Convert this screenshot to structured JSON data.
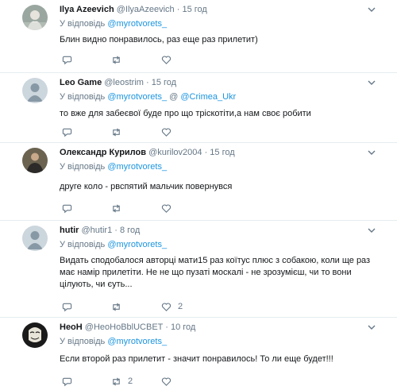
{
  "tweets": [
    {
      "name": "Ilya Azeevich",
      "handle": "@IlyaAzeevich",
      "time": "15 год",
      "reply_prefix": "У відповідь",
      "reply_to": [
        "@myrotvorets_"
      ],
      "lines": [
        "Блин видно понравилось,  раз еще раз прилетит)"
      ],
      "reply_count": "",
      "retweet_count": "",
      "like_count": ""
    },
    {
      "name": "Leo Game",
      "handle": "@leostrim",
      "time": "15 год",
      "reply_prefix": "У відповідь",
      "reply_to": [
        "@myrotvorets_",
        "@Crimea_Ukr"
      ],
      "lines": [
        "то вже для     забеєвої буде про що тріскотіти,а нам своє робити"
      ],
      "reply_count": "",
      "retweet_count": "",
      "like_count": ""
    },
    {
      "name": "Олександр Курилов",
      "handle": "@kurilov2004",
      "time": "15 год",
      "reply_prefix": "У відповідь",
      "reply_to": [
        "@myrotvorets_"
      ],
      "lines": [
        "друге коло - рвспятий мальчик повернувся"
      ],
      "reply_count": "",
      "retweet_count": "",
      "like_count": ""
    },
    {
      "name": "hutir",
      "handle": "@hutir1",
      "time": "8 год",
      "reply_prefix": "У відповідь",
      "reply_to": [
        "@myrotvorets_"
      ],
      "lines": [
        "Видать сподобалося авторці мати15 раз  коїтус плюс з собакою, коли ще раз",
        "має намір прилетіти. Не не що пузаті москалі - не зрозумієш, чи то вони",
        "цілують, чи єуть..."
      ],
      "reply_count": "",
      "retweet_count": "",
      "like_count": "2"
    },
    {
      "name": "НеоН",
      "handle": "@НеоНоВblUCBET",
      "time": "10 год",
      "reply_prefix": "У відповідь",
      "reply_to": [
        "@myrotvorets_"
      ],
      "lines": [
        "Если второй раз прилетит - значит понравилось! То ли еще будет!!!"
      ],
      "reply_count": "",
      "retweet_count": "2",
      "like_count": ""
    }
  ],
  "colors": {
    "text": "#14171a",
    "muted": "#657786",
    "link": "#1b95e0",
    "border": "#e6ecf0"
  },
  "icons": {
    "reply": "reply-icon",
    "retweet": "retweet-icon",
    "like": "heart-icon",
    "menu": "chevron-down-icon"
  }
}
